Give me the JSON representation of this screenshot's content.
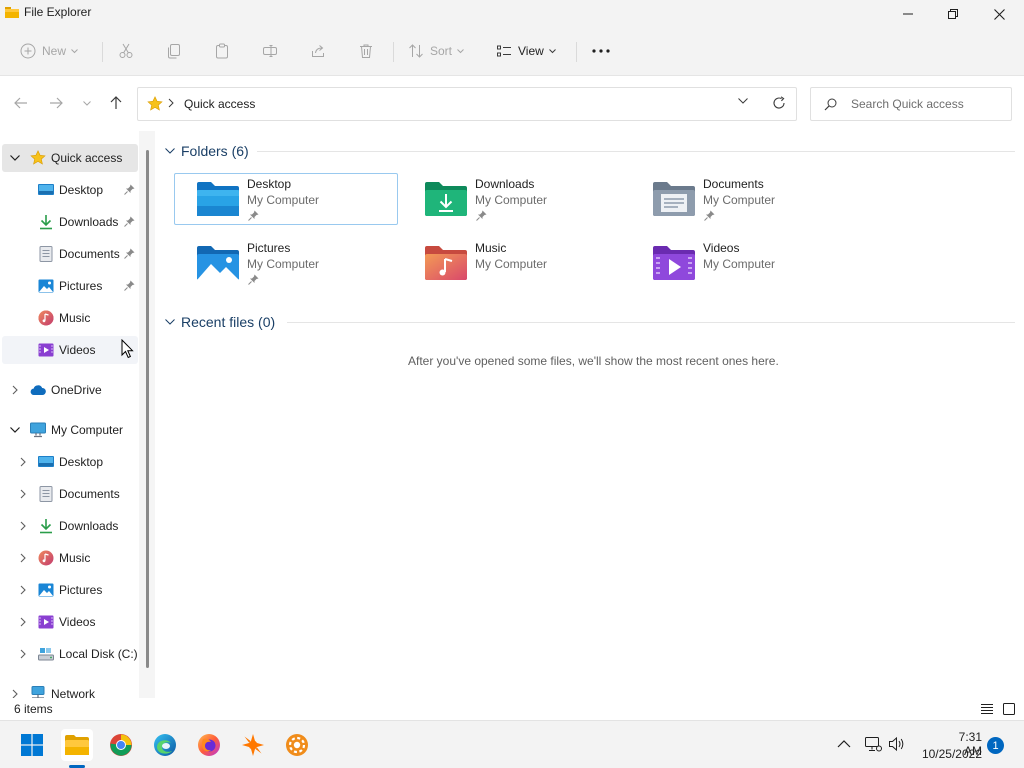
{
  "window": {
    "title": "File Explorer"
  },
  "toolbar": {
    "new_label": "New",
    "sort_label": "Sort",
    "view_label": "View"
  },
  "address": {
    "location": "Quick access",
    "search_placeholder": "Search Quick access"
  },
  "navpane": {
    "quick_access": "Quick access",
    "quick_items": [
      "Desktop",
      "Downloads",
      "Documents",
      "Pictures",
      "Music",
      "Videos"
    ],
    "onedrive": "OneDrive",
    "my_computer": "My Computer",
    "computer_items": [
      "Desktop",
      "Documents",
      "Downloads",
      "Music",
      "Pictures",
      "Videos",
      "Local Disk (C:)"
    ],
    "network": "Network"
  },
  "content": {
    "folders_header": "Folders (6)",
    "recent_header": "Recent files (0)",
    "empty_message": "After you've opened some files, we'll show the most recent ones here.",
    "folders": [
      {
        "name": "Desktop",
        "location": "My Computer"
      },
      {
        "name": "Downloads",
        "location": "My Computer"
      },
      {
        "name": "Documents",
        "location": "My Computer"
      },
      {
        "name": "Pictures",
        "location": "My Computer"
      },
      {
        "name": "Music",
        "location": "My Computer"
      },
      {
        "name": "Videos",
        "location": "My Computer"
      }
    ]
  },
  "status": {
    "item_count": "6 items"
  },
  "taskbar": {
    "time": "7:31 AM",
    "date": "10/25/2022",
    "notifications": "1"
  },
  "colors": {
    "accent": "#0067c0",
    "selection_border": "#99c9ef",
    "group_header": "#1a3f66"
  }
}
